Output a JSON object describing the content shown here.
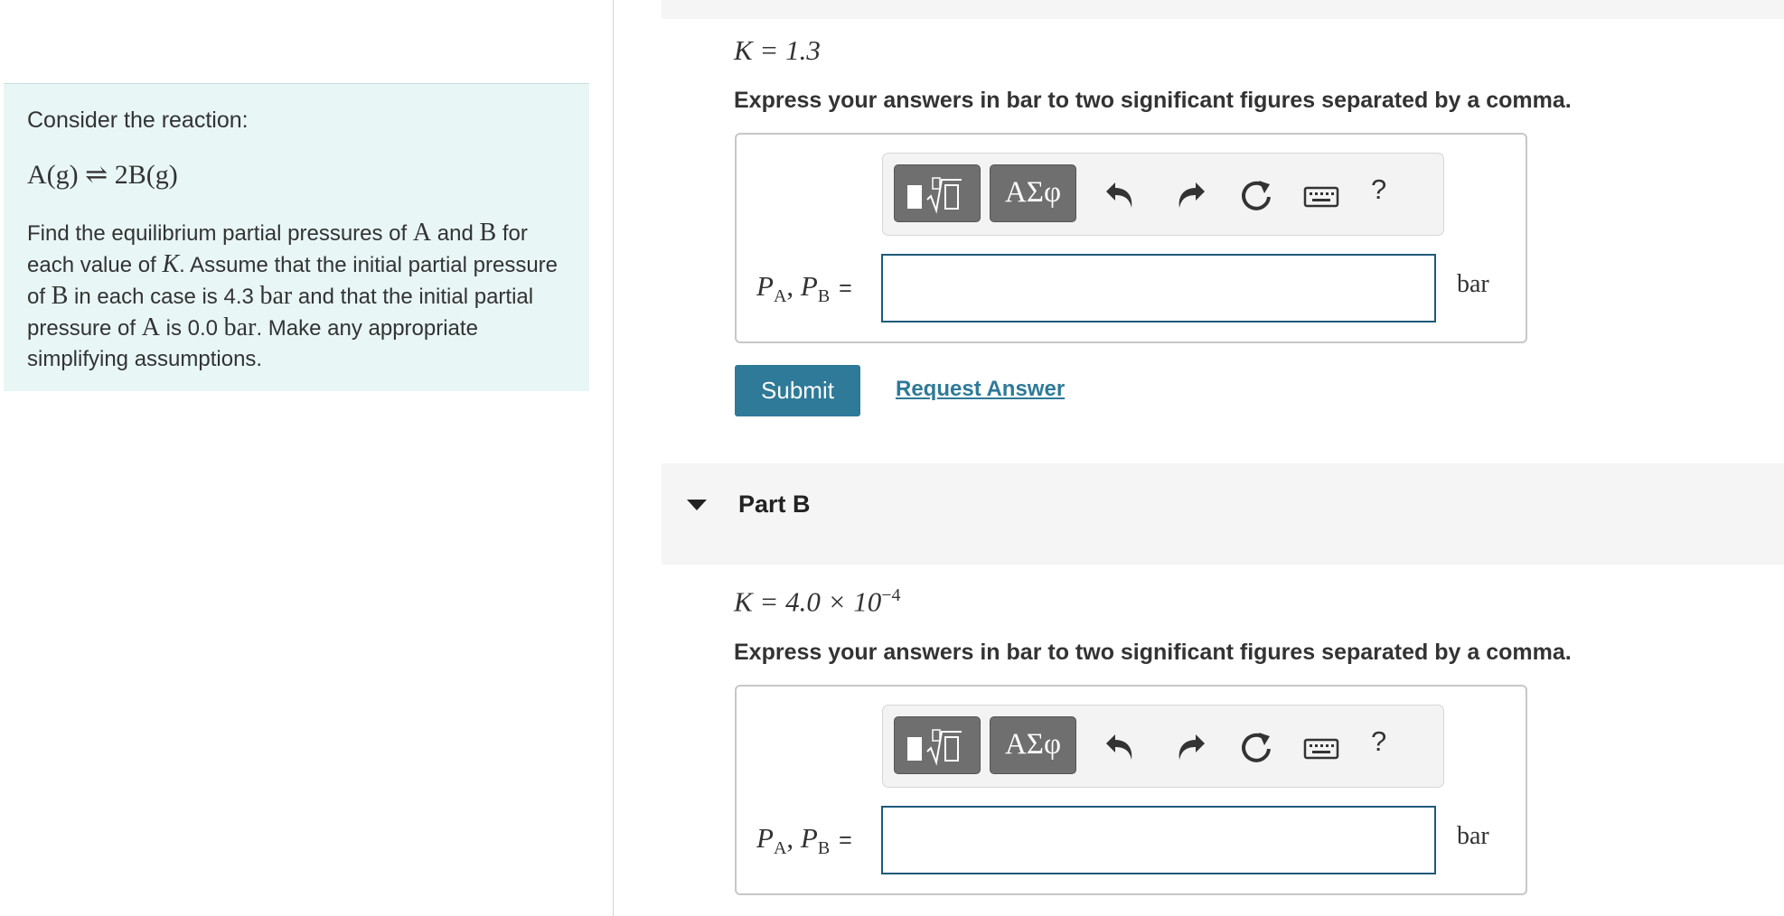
{
  "problem": {
    "intro": "Consider the reaction:",
    "reaction": "A(g) ⇌ 2B(g)",
    "desc": {
      "p1": "Find the equilibrium partial pressures of ",
      "A": "A",
      "and": " and ",
      "B": "B",
      "p2": " for each value of ",
      "K": "K",
      "p3": ". Assume that the initial partial pressure of ",
      "B2": "B",
      "p4": " in each case is 4.3 ",
      "bar1": "bar",
      "p5": " and that the initial partial pressure of ",
      "A2": "A",
      "p6": " is 0.0 ",
      "bar2": "bar",
      "p7": ". Make any appropriate simplifying assumptions."
    }
  },
  "partA": {
    "k_value": "K = 1.3",
    "instruction": "Express your answers in bar to two significant figures separated by a comma.",
    "label_p": "P",
    "label_sub_a": "A",
    "label_sep": ", ",
    "label_sub_b": "B",
    "equals": "=",
    "input_value": "",
    "unit": "bar",
    "toolbar": {
      "greek": "ΑΣφ",
      "help": "?"
    },
    "submit": "Submit",
    "request": "Request Answer"
  },
  "partB": {
    "title": "Part B",
    "k_base": "K = 4.0 × 10",
    "k_exp": "−4",
    "instruction": "Express your answers in bar to two significant figures separated by a comma.",
    "label_p": "P",
    "label_sub_a": "A",
    "label_sep": ", ",
    "label_sub_b": "B",
    "equals": "=",
    "input_value": "",
    "unit": "bar",
    "toolbar": {
      "greek": "ΑΣφ",
      "help": "?"
    }
  },
  "icons": {
    "templates": "templates-icon",
    "undo": "undo-icon",
    "redo": "redo-icon",
    "reset": "reset-icon",
    "keyboard": "keyboard-icon",
    "collapse": "chevron-down-icon"
  }
}
